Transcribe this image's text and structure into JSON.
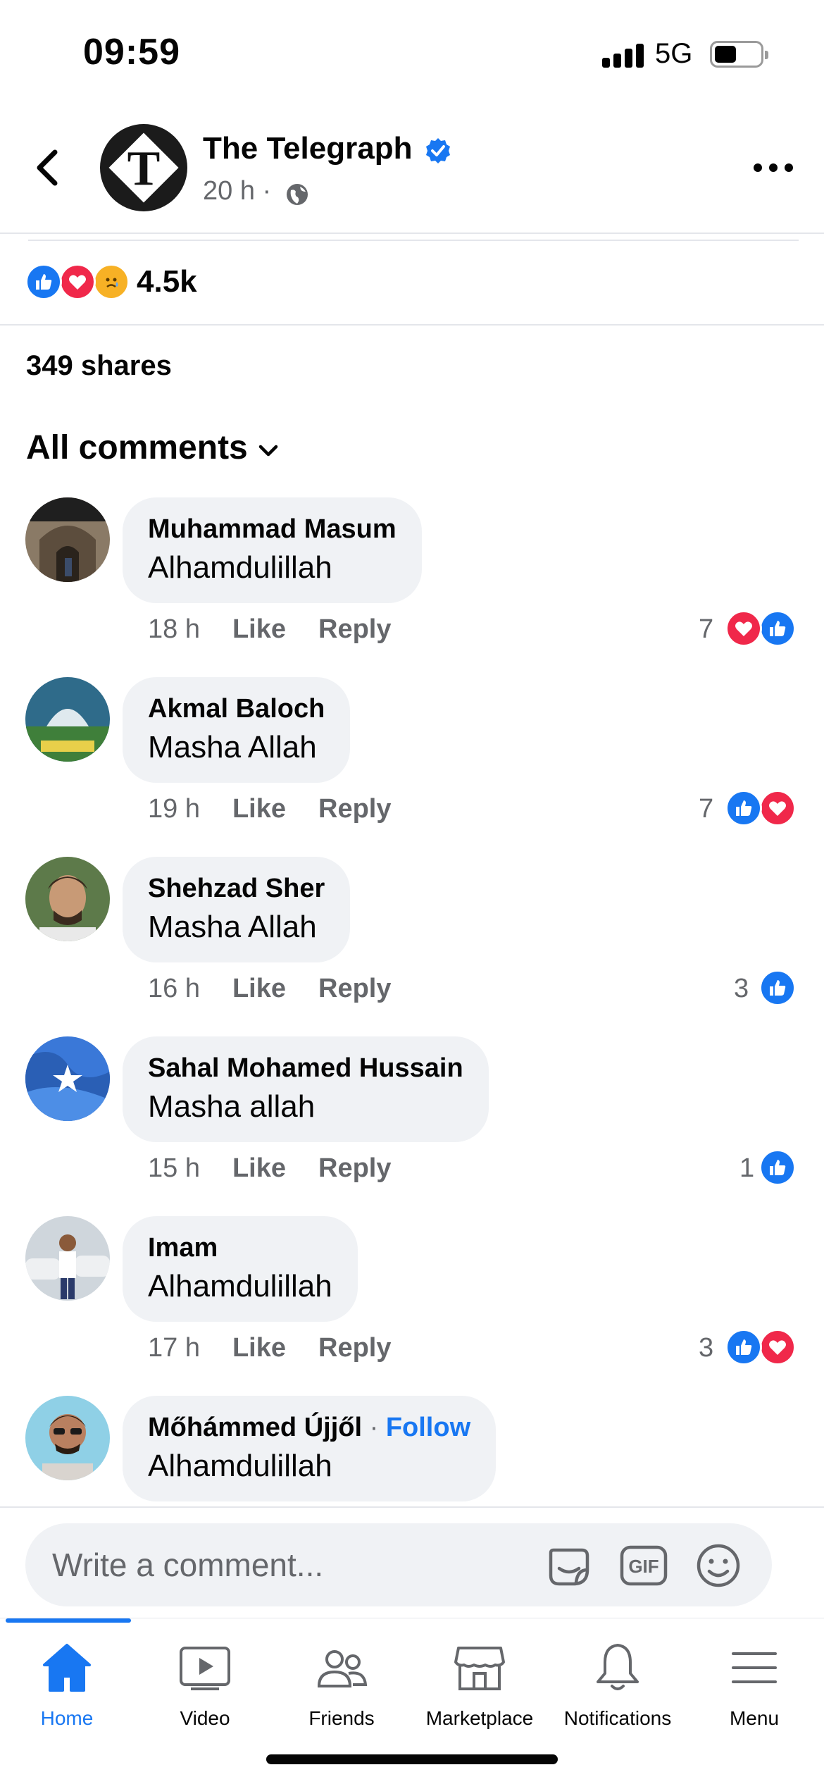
{
  "status_bar": {
    "time": "09:59",
    "network": "5G"
  },
  "header": {
    "page_name": "The Telegraph",
    "avatar_letter": "T",
    "post_time": "20 h ·",
    "icons": [
      "back-chevron-icon",
      "verified-badge-icon",
      "globe-icon",
      "more-options-icon"
    ]
  },
  "reactions": {
    "count": "4.5k",
    "icons": [
      "like-icon",
      "love-icon",
      "sad-icon"
    ]
  },
  "shares": "349 shares",
  "comments_filter": "All comments",
  "comment_actions": {
    "like": "Like",
    "reply": "Reply"
  },
  "comments": [
    {
      "name": "Muhammad Masum",
      "text": "Alhamdulillah",
      "time": "18 h",
      "reaction_count": "7",
      "reactions": [
        "love",
        "like"
      ]
    },
    {
      "name": "Akmal Baloch",
      "text": "Masha Allah",
      "time": "19 h",
      "reaction_count": "7",
      "reactions": [
        "like",
        "love"
      ]
    },
    {
      "name": "Shehzad Sher",
      "text": "Masha Allah",
      "time": "16 h",
      "reaction_count": "3",
      "reactions": [
        "like"
      ]
    },
    {
      "name": "Sahal Mohamed Hussain",
      "text": "Masha allah",
      "time": "15 h",
      "reaction_count": "1",
      "reactions": [
        "like"
      ]
    },
    {
      "name": "Imam",
      "text": "Alhamdulillah",
      "time": "17 h",
      "reaction_count": "3",
      "reactions": [
        "like",
        "love"
      ]
    },
    {
      "name": "Mőhámmed Újjől",
      "follow": "Follow",
      "separator": "·",
      "text": "Alhamdulillah"
    }
  ],
  "composer": {
    "placeholder": "Write a comment...",
    "icons": [
      "sticker-icon",
      "gif-icon",
      "emoji-icon"
    ]
  },
  "nav": [
    {
      "label": "Home",
      "icon": "home-icon",
      "active": true
    },
    {
      "label": "Video",
      "icon": "video-icon"
    },
    {
      "label": "Friends",
      "icon": "friends-icon"
    },
    {
      "label": "Marketplace",
      "icon": "marketplace-icon"
    },
    {
      "label": "Notifications",
      "icon": "bell-icon"
    },
    {
      "label": "Menu",
      "icon": "menu-icon"
    }
  ],
  "colors": {
    "accent": "#1877f2",
    "love": "#f0284a",
    "sad": "#f7b125",
    "bubble": "#f0f2f5",
    "secondary_text": "#65676b"
  }
}
